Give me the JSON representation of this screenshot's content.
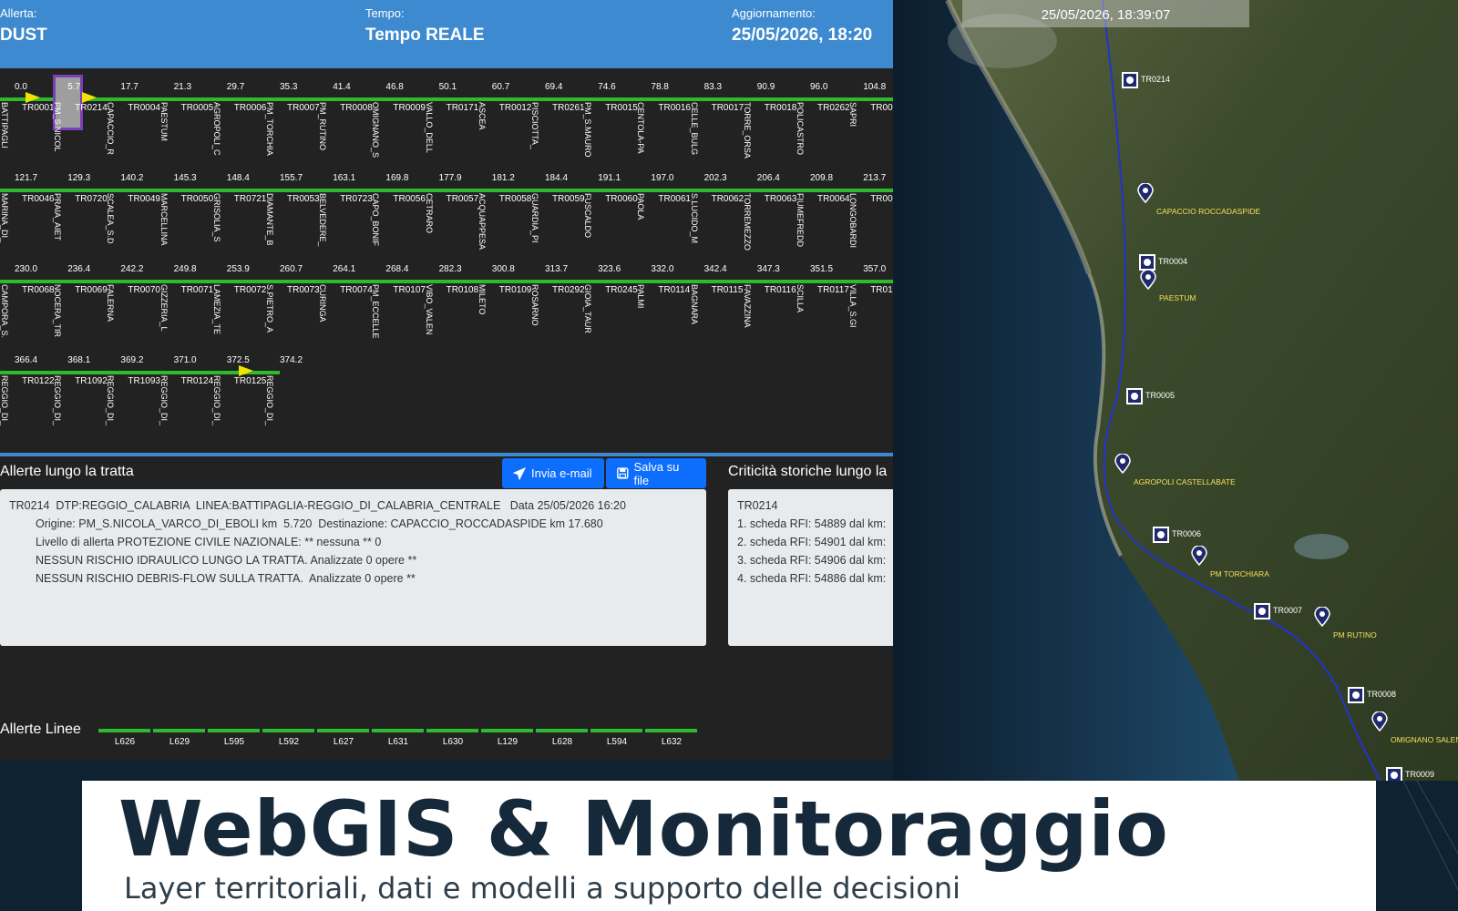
{
  "header": {
    "allerta_label": "Allerta:",
    "allerta_value": "DUST",
    "tempo_label": "Tempo:",
    "tempo_value": "Tempo REALE",
    "aggiornamento_label": "Aggiornamento:",
    "aggiornamento_value": "25/05/2026, 18:20"
  },
  "strips": [
    {
      "km": [
        "0.0",
        "5.7",
        "17.7",
        "21.3",
        "29.7",
        "35.3",
        "41.4",
        "46.8",
        "50.1",
        "60.7",
        "69.4",
        "74.6",
        "78.8",
        "83.3",
        "90.9",
        "96.0",
        "104.8"
      ],
      "tr": [
        "TR0001",
        "TR0214",
        "TR0004",
        "TR0005",
        "TR0006",
        "TR0007",
        "TR0008",
        "TR0009",
        "TR0171",
        "TR0012",
        "TR0261",
        "TR0015",
        "TR0016",
        "TR0017",
        "TR0018",
        "TR0262",
        "TR00"
      ],
      "stations": [
        "BATTIPAGLI",
        "PM_S.NICOL",
        "CAPACCIO_R",
        "PAESTUM",
        "AGROPOLI_C",
        "PM_TORCHIA",
        "PM_RUTINO",
        "OMIGNANO_S",
        "VALLO_DELL",
        "ASCEA",
        "PISCIOTTA_",
        "PM_S.MAURO",
        "CENTOLA-PA",
        "CELLE_BULG",
        "TORRE_ORSA",
        "POLICASTRO",
        "SAPRI"
      ]
    },
    {
      "km": [
        "121.7",
        "129.3",
        "140.2",
        "145.3",
        "148.4",
        "155.7",
        "163.1",
        "169.8",
        "177.9",
        "181.2",
        "184.4",
        "191.1",
        "197.0",
        "202.3",
        "206.4",
        "209.8",
        "213.7"
      ],
      "tr": [
        "TR0046",
        "TR0720",
        "TR0049",
        "TR0050",
        "TR0721",
        "TR0053",
        "TR0723",
        "TR0056",
        "TR0057",
        "TR0058",
        "TR0059",
        "TR0060",
        "TR0061",
        "TR0062",
        "TR0063",
        "TR0064",
        "TR00"
      ],
      "stations": [
        "MARINA_DI_",
        "PRAIA_AIET",
        "SCALEA_S.D",
        "MARCELLINA",
        "GRISOLIA_S",
        "DIAMANTE_B",
        "BELVEDERE_",
        "CAPO_BONIF",
        "CETRARO",
        "ACQUAPPESA",
        "GUARDIA_PI",
        "FUSCALDO",
        "PAOLA",
        "S.LUCIDO_M",
        "TORREMEZZO",
        "FIUMEFREDD",
        "LONGOBARDI"
      ]
    },
    {
      "km": [
        "230.0",
        "236.4",
        "242.2",
        "249.8",
        "253.9",
        "260.7",
        "264.1",
        "268.4",
        "282.3",
        "300.8",
        "313.7",
        "323.6",
        "332.0",
        "342.4",
        "347.3",
        "351.5",
        "357.0"
      ],
      "tr": [
        "TR0068",
        "TR0069",
        "TR0070",
        "TR0071",
        "TR0072",
        "TR0073",
        "TR0074",
        "TR0107",
        "TR0108",
        "TR0109",
        "TR0292",
        "TR0245",
        "TR0114",
        "TR0115",
        "TR0116",
        "TR0117",
        "TR01"
      ],
      "stations": [
        "CAMPORA_S.",
        "NOCERA_TIR",
        "FALERNA",
        "GIZZERIA_L",
        "LAMEZIA_TE",
        "S.PIETRO_A",
        "CURINGA",
        "PM_ECCELLE",
        "VIBO_VALEN",
        "MILETO",
        "ROSARNO",
        "GIOIA_TAUR",
        "PALMI",
        "BAGNARA",
        "FAVAZZINA",
        "SCILLA",
        "VILLA_S.GI"
      ]
    },
    {
      "km": [
        "366.4",
        "368.1",
        "369.2",
        "371.0",
        "372.5",
        "374.2"
      ],
      "tr": [
        "TR0122",
        "TR1092",
        "TR1093",
        "TR0124",
        "TR0125",
        ""
      ],
      "stations": [
        "REGGIO_DI_",
        "REGGIO_DI_",
        "REGGIO_DI_",
        "REGGIO_DI_",
        "REGGIO_DI_",
        "REGGIO_DI_"
      ]
    }
  ],
  "alerts": {
    "title": "Allerte lungo la tratta",
    "email_button": "Invia e-mail",
    "save_button": "Salva su file",
    "line1": "TR0214  DTP:REGGIO_CALABRIA  LINEA:BATTIPAGLIA-REGGIO_DI_CALABRIA_CENTRALE   Data 25/05/2026 16:20",
    "line2": "Origine: PM_S.NICOLA_VARCO_DI_EBOLI km  5.720  Destinazione: CAPACCIO_ROCCADASPIDE km 17.680",
    "line3": "Livello di allerta PROTEZIONE CIVILE NAZIONALE: ** nessuna ** 0",
    "line4": "NESSUN RISCHIO IDRAULICO LUNGO LA TRATTA. Analizzate 0 opere **",
    "line5": "NESSUN RISCHIO DEBRIS-FLOW SULLA TRATTA.  Analizzate 0 opere **"
  },
  "critical": {
    "title": "Criticità storiche lungo la",
    "lines": [
      "TR0214",
      "1. scheda RFI: 54889 dal km:",
      "2. scheda RFI: 54901 dal km:",
      "3. scheda RFI: 54906 dal km:",
      "4. scheda RFI: 54886 dal km:"
    ]
  },
  "lines": {
    "title": "Allerte Linee",
    "items": [
      "L626",
      "L629",
      "L595",
      "L592",
      "L627",
      "L631",
      "L630",
      "L129",
      "L628",
      "L594",
      "L632"
    ]
  },
  "map": {
    "timestamp": "25/05/2026, 18:39:07",
    "markers": [
      {
        "type": "square",
        "label": "TR0214"
      },
      {
        "type": "pin",
        "label": "CAPACCIO ROCCADASPIDE"
      },
      {
        "type": "square",
        "label": "TR0004"
      },
      {
        "type": "pin",
        "label": "PAESTUM"
      },
      {
        "type": "square",
        "label": "TR0005"
      },
      {
        "type": "pin",
        "label": "AGROPOLI CASTELLABATE"
      },
      {
        "type": "square",
        "label": "TR0006"
      },
      {
        "type": "pin",
        "label": "PM TORCHIARA"
      },
      {
        "type": "square",
        "label": "TR0007"
      },
      {
        "type": "pin",
        "label": "PM RUTINO"
      },
      {
        "type": "square",
        "label": "TR0008"
      },
      {
        "type": "pin",
        "label": "OMIGNANO SALENTO"
      },
      {
        "type": "square",
        "label": "TR0009"
      }
    ]
  },
  "banner": {
    "title": "WebGIS & Monitoraggio",
    "subtitle": "Layer territoriali, dati e modelli a supporto delle decisioni"
  }
}
